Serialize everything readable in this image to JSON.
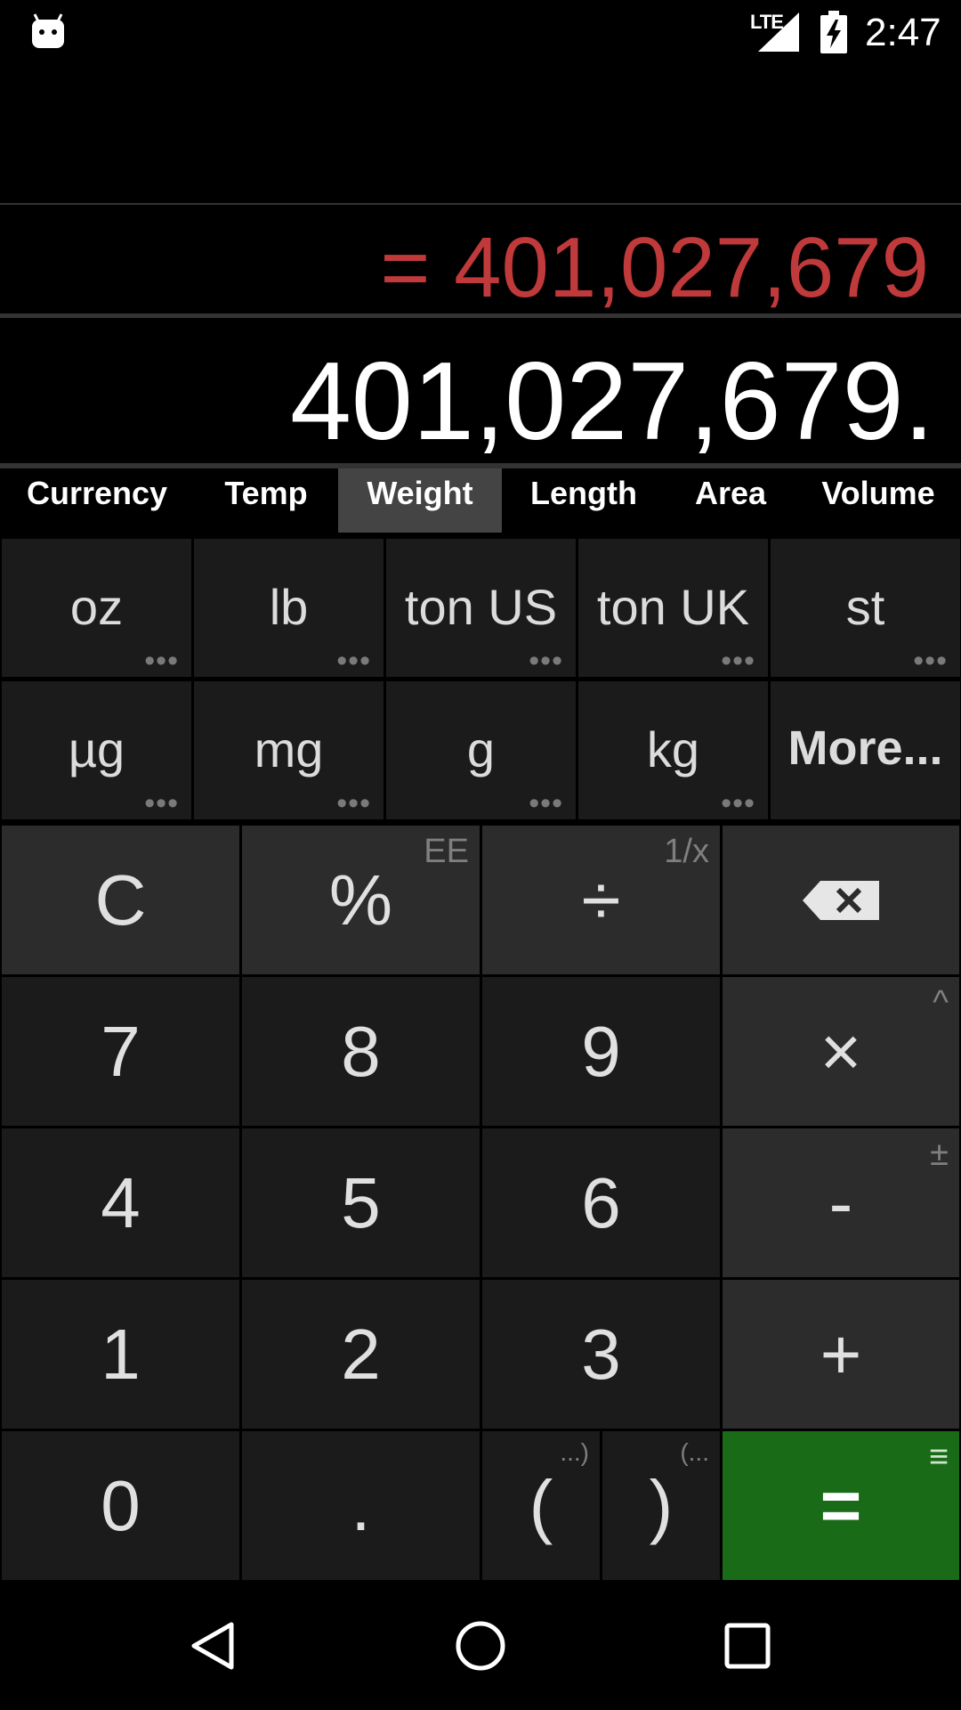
{
  "status": {
    "network": "LTE",
    "time": "2:47"
  },
  "display": {
    "result": "= 401,027,679",
    "input": "401,027,679."
  },
  "tabs": [
    "Currency",
    "Temp",
    "Weight",
    "Length",
    "Area",
    "Volume"
  ],
  "active_tab": "Weight",
  "units": {
    "row1": [
      "oz",
      "lb",
      "ton US",
      "ton UK",
      "st"
    ],
    "row2": [
      "µg",
      "mg",
      "g",
      "kg",
      "More..."
    ],
    "more_dots": "•••"
  },
  "keypad": {
    "clear": "C",
    "percent": "%",
    "percent_alt": "EE",
    "divide": "÷",
    "divide_alt": "1/x",
    "backspace": "backspace",
    "seven": "7",
    "eight": "8",
    "nine": "9",
    "multiply": "×",
    "multiply_alt": "^",
    "four": "4",
    "five": "5",
    "six": "6",
    "minus": "-",
    "minus_alt": "±",
    "one": "1",
    "two": "2",
    "three": "3",
    "plus": "+",
    "zero": "0",
    "decimal": ".",
    "open_paren": "(",
    "open_paren_alt": "...)",
    "close_paren": ")",
    "close_paren_alt": "(...",
    "equals": "=",
    "equals_alt": "≡"
  },
  "colors": {
    "result": "#c0393b",
    "equals_key": "#1a6b18",
    "active_tab": "#444444"
  }
}
